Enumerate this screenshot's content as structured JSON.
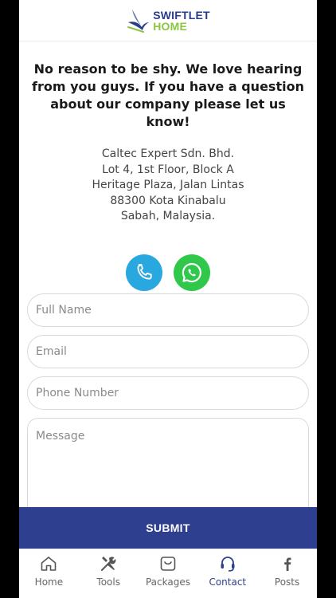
{
  "header": {
    "logo_line1": "SWIFTLET",
    "logo_line2": "HOME"
  },
  "intro": {
    "text": "No reason to be shy. We love hearing from you guys. If you have a question about our company please let us know!"
  },
  "address": {
    "line1": "Caltec Expert Sdn. Bhd.",
    "line2": "Lot 4, 1st Floor, Block A",
    "line3": "Heritage Plaza, Jalan Lintas",
    "line4": "88300 Kota Kinabalu",
    "line5": "Sabah, Malaysia."
  },
  "contact_icons": {
    "phone": "phone-icon",
    "whatsapp": "whatsapp-icon"
  },
  "form": {
    "full_name_placeholder": "Full Name",
    "email_placeholder": "Email",
    "phone_placeholder": "Phone Number",
    "message_placeholder": "Message",
    "submit_label": "SUBMIT"
  },
  "tabbar": {
    "items": [
      {
        "label": "Home",
        "icon": "home-icon"
      },
      {
        "label": "Tools",
        "icon": "tools-icon"
      },
      {
        "label": "Packages",
        "icon": "packages-icon"
      },
      {
        "label": "Contact",
        "icon": "headset-icon"
      },
      {
        "label": "Posts",
        "icon": "facebook-icon"
      }
    ],
    "active": "Contact"
  },
  "colors": {
    "brand_blue": "#2d3f8e",
    "brand_green": "#8cc63f",
    "phone_blue": "#29a8e0",
    "whatsapp_green": "#2fc84b"
  }
}
